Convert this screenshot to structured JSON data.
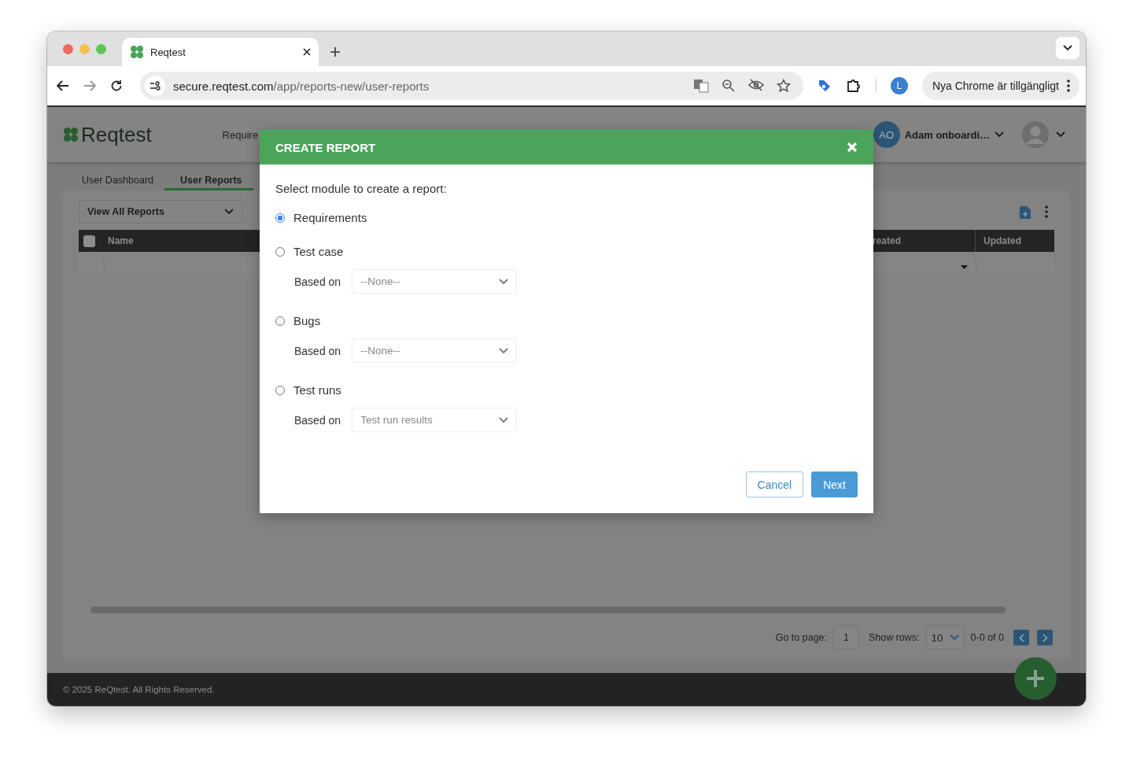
{
  "browser": {
    "tab_title": "Reqtest",
    "url_host": "secure.reqtest.com",
    "url_path": "/app/reports-new/user-reports",
    "profile_initial": "L",
    "update_button": "Nya Chrome är tillgängligt"
  },
  "app": {
    "logo": "Reqtest",
    "nav_items": [
      "Require"
    ],
    "user": {
      "initials": "AO",
      "name": "Adam onboardi…"
    },
    "tabs": [
      {
        "label": "User Dashboard",
        "selected": false
      },
      {
        "label": "User Reports",
        "selected": true
      }
    ],
    "view_select": "View All Reports",
    "table": {
      "select_all_checked": false,
      "columns": [
        "Name",
        "reated",
        "Updated"
      ]
    },
    "pagination": {
      "go_to_label": "Go to page:",
      "page": "1",
      "rows_label": "Show rows:",
      "rows": "10",
      "range": "0-0 of 0"
    },
    "footer": "© 2025 ReQtest. All Rights Reserved."
  },
  "modal": {
    "title": "CREATE REPORT",
    "prompt": "Select module to create a report:",
    "options": [
      {
        "label": "Requirements",
        "selected": true
      },
      {
        "label": "Test case",
        "selected": false,
        "based_on": {
          "label": "Based on",
          "value": "--None--"
        }
      },
      {
        "label": "Bugs",
        "selected": false,
        "based_on": {
          "label": "Based on",
          "value": "--None--"
        }
      },
      {
        "label": "Test runs",
        "selected": false,
        "based_on": {
          "label": "Based on",
          "value": "Test run results"
        }
      }
    ],
    "buttons": [
      {
        "label": "Cancel",
        "kind": "secondary"
      },
      {
        "label": "Next",
        "kind": "primary"
      }
    ]
  }
}
